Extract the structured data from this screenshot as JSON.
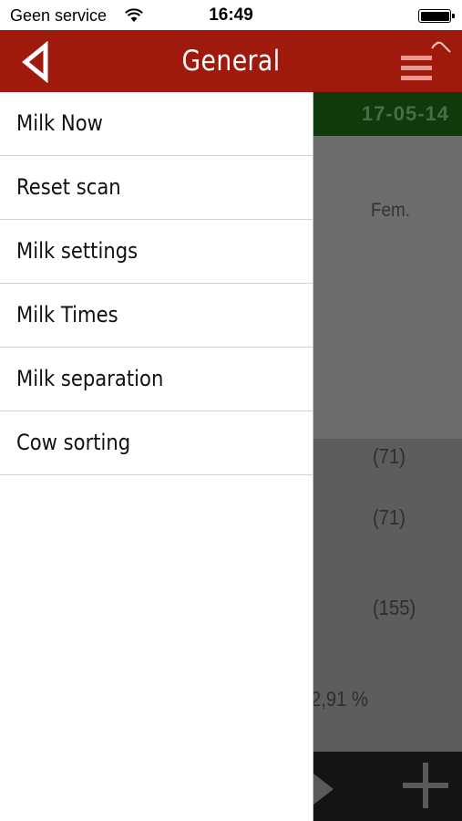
{
  "status_bar": {
    "carrier": "Geen service",
    "time": "16:49",
    "wifi_icon": "wifi-icon",
    "battery_icon": "battery-icon"
  },
  "header": {
    "title": "General",
    "back_icon": "back-triangle-icon",
    "menu_icon": "hamburger-menu-icon",
    "background_color": "#a0190d"
  },
  "drawer": {
    "items": [
      {
        "label": "Milk Now"
      },
      {
        "label": "Reset scan"
      },
      {
        "label": "Milk settings"
      },
      {
        "label": "Milk Times"
      },
      {
        "label": "Milk separation"
      },
      {
        "label": "Cow sorting"
      }
    ]
  },
  "background_screen": {
    "date": "17-05-14",
    "column_header": "Fem.",
    "values": [
      "(71)",
      "(71)",
      "(155)",
      "2,91 %"
    ],
    "date_bar_color": "#0f3b0c"
  }
}
